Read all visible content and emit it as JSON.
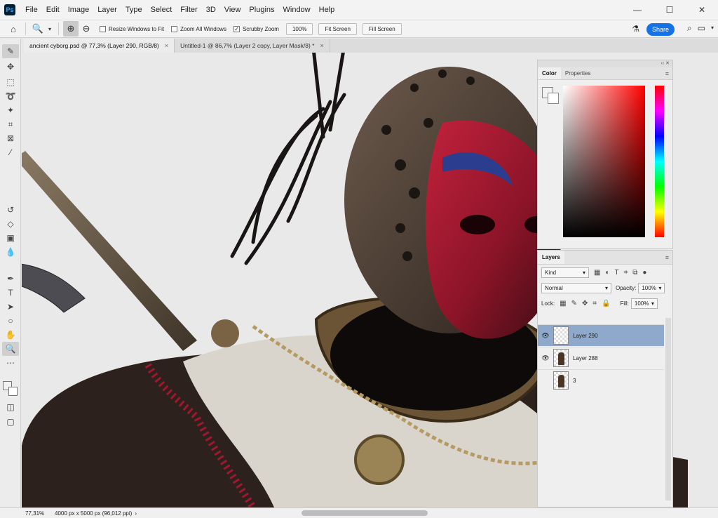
{
  "app": {
    "logo": "Ps"
  },
  "menu": [
    "File",
    "Edit",
    "Image",
    "Layer",
    "Type",
    "Select",
    "Filter",
    "3D",
    "View",
    "Plugins",
    "Window",
    "Help"
  ],
  "window_controls": {
    "minimize": "—",
    "maximize": "☐",
    "close": "✕"
  },
  "options_bar": {
    "resize_windows": "Resize Windows to Fit",
    "zoom_all": "Zoom All Windows",
    "scrubby_zoom": "Scrubby Zoom",
    "scrubby_checked": "✓",
    "zoom_value": "100%",
    "fit_screen": "Fit Screen",
    "fill_screen": "Fill Screen",
    "share": "Share"
  },
  "tabs": [
    {
      "label": "ancient cyborg.psd @ 77,3% (Layer 290, RGB/8)",
      "close": "×"
    },
    {
      "label": "Untitled-1 @ 86,7% (Layer 2 copy, Layer Mask/8) *",
      "close": "×"
    }
  ],
  "color_panel": {
    "tabs": [
      "Color",
      "Properties"
    ],
    "foreground": "#f2f2f2",
    "background": "#ffffff"
  },
  "layers_panel": {
    "title": "Layers",
    "filter_kind": "Kind",
    "blend_mode": "Normal",
    "opacity_label": "Opacity:",
    "opacity_value": "100%",
    "lock_label": "Lock:",
    "fill_label": "Fill:",
    "fill_value": "100%",
    "layers": [
      {
        "name": "Layer 290",
        "visible": true,
        "selected": true
      },
      {
        "name": "Layer 288",
        "visible": true,
        "selected": false
      },
      {
        "name": "3",
        "visible": false,
        "selected": false
      }
    ]
  },
  "status_bar": {
    "zoom": "77,31%",
    "doc_info": "4000 px x 5000 px (96,012 ppi)"
  },
  "colors": {
    "accent": "#1473e6",
    "layer_selected": "#8fa9cc",
    "mask_red": "#a01830"
  }
}
